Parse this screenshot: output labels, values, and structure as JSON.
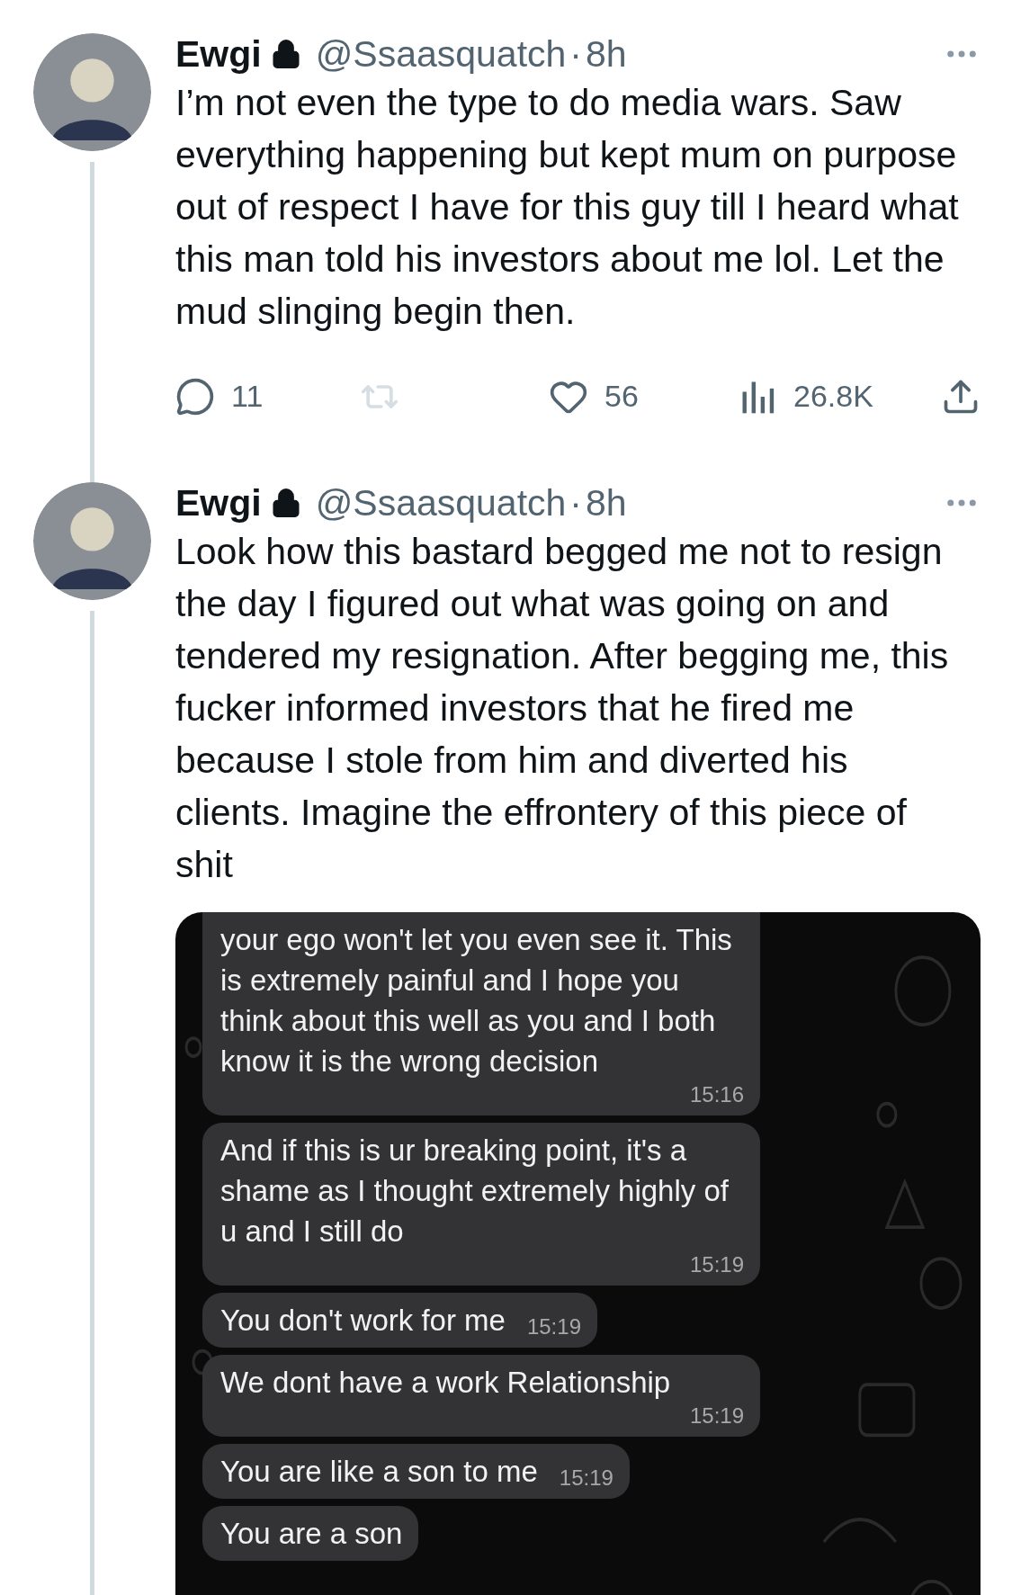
{
  "tweets": [
    {
      "author": "Ewgi",
      "locked": true,
      "handle": "@Ssaasquatch",
      "separator": "·",
      "time": "8h",
      "text": "I’m not even the type to do media wars. Saw everything happening but kept mum on purpose out of respect I have for this guy till I heard what this man told his investors about me lol. Let the mud slinging begin then.",
      "actions": [
        {
          "kind": "reply",
          "count": "11",
          "disabled": false
        },
        {
          "kind": "retweet",
          "disabled": true
        },
        {
          "kind": "like",
          "count": "56",
          "disabled": false
        },
        {
          "kind": "views",
          "count": "26.8K",
          "disabled": false
        },
        {
          "kind": "share",
          "disabled": false
        }
      ]
    },
    {
      "author": "Ewgi",
      "locked": true,
      "handle": "@Ssaasquatch",
      "separator": "·",
      "time": "8h",
      "text": "Look how this bastard begged me not to resign the day I figured out what was going on and tendered my resignation. After begging me, this fucker informed investors that he fired me because I stole from him and diverted his clients. Imagine the effrontery of this piece of shit",
      "attachment": {
        "kind": "chat_screenshot",
        "messages": [
          {
            "text": "your ego won't let you even see it. This is extremely painful and I hope you think about this well as you and I both know it is the wrong decision",
            "time": "15:16"
          },
          {
            "text": "And if this is ur breaking point, it's a shame as I thought extremely highly of u and I still do",
            "time": "15:19"
          },
          {
            "text": "You don't work for me",
            "time": "15:19"
          },
          {
            "text": "We dont have a work Relationship",
            "time": "15:19"
          },
          {
            "text": "You are like a son to me",
            "time": "15:19"
          },
          {
            "text": "You are a son"
          }
        ]
      }
    }
  ]
}
